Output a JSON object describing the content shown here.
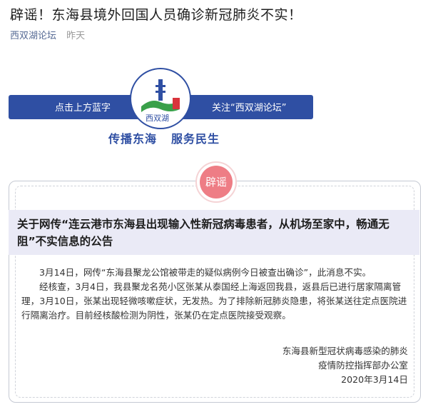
{
  "article": {
    "title": "辟谣！东海县境外回国人员确诊新冠肺炎不实！",
    "source": "西双湖论坛",
    "time": "昨天"
  },
  "banner": {
    "left_text": "点击上方蓝字",
    "right_text": "关注“西双湖论坛”",
    "logo_text": "西双湖",
    "slogan_1": "传播东海",
    "slogan_2": "服务民生"
  },
  "notice": {
    "stamp": "辟谣",
    "headline": "关于网传“连云港市东海县出现输入性新冠病毒患者，从机场至家中，畅通无阻”不实信息的公告",
    "paragraphs": [
      "3月14日，网传“东海县聚龙公馆被带走的疑似病例今日被查出确诊”，此消息不实。",
      "经核查，3月4日，我县聚龙名苑小区张某从泰国经上海返回我县，返县后已进行居家隔离管理，3月10日，张某出现轻微咳嗽症状，无发热。为了排除新冠肺炎隐患，将张某送往定点医院进行隔离治疗。目前经核酸检测为阴性，张某仍在定点医院接受观察。"
    ],
    "sign_1": "东海县新型冠状病毒感染的肺炎",
    "sign_2": "疫情防控指挥部办公室",
    "date": "2020年3月14日"
  },
  "colors": {
    "banner_blue": "#2f4fa3",
    "stamp_pink": "#ee7d85",
    "headline_bg": "#eaeaf6",
    "link": "#576b95"
  }
}
